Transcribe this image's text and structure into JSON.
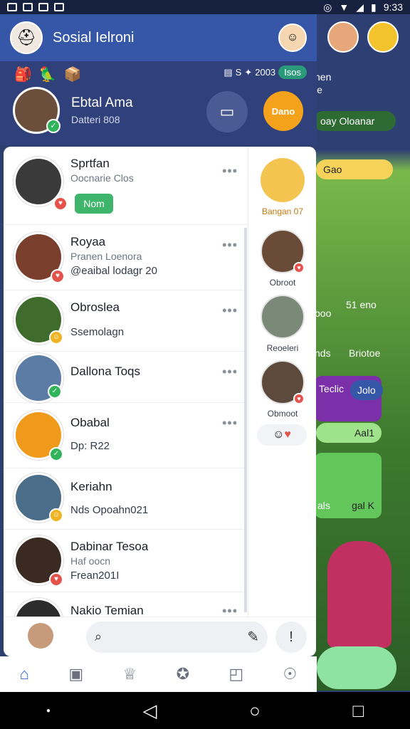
{
  "status_bar": {
    "time": "9:33",
    "icons_left": [
      "image-icon",
      "save-icon",
      "shield-icon",
      "heart-icon"
    ],
    "icons_right": [
      "alarm-icon",
      "wifi-icon",
      "signal-icon",
      "battery-icon"
    ]
  },
  "header": {
    "title": "Sosial Ielroni"
  },
  "sub_header": {
    "emojis": [
      "🎒",
      "🦜",
      "📦"
    ],
    "stat1": "S",
    "stat2": "2003",
    "stat_pill": "Isos"
  },
  "current_user": {
    "name": "Ebtal Ama",
    "sub": "Datteri 808",
    "btn_label": "Dano"
  },
  "chats": [
    {
      "name": "Sprtfan",
      "line1": "Oocnarie Clos",
      "line2": "",
      "button": "Nom"
    },
    {
      "name": "Royaa",
      "line1": "Pranen Loenora",
      "line2": "@eaibal lodagr 20"
    },
    {
      "name": "Obroslea",
      "line1": "",
      "line2": "Ssemolagn"
    },
    {
      "name": "Dallona Toqs",
      "line1": "",
      "line2": ""
    },
    {
      "name": "Obabal",
      "line1": "",
      "line2": "Dp: R22"
    },
    {
      "name": "Keriahn",
      "line1": "",
      "line2": "Nds Opoahn021"
    },
    {
      "name": "Dabinar Tesoa",
      "line1": "Haf oocn",
      "line2": "Frean201I"
    },
    {
      "name": "Nakio Temian",
      "line1": "",
      "line2": ""
    }
  ],
  "stories": [
    {
      "label": "Bangan 07"
    },
    {
      "label": "Obroot"
    },
    {
      "label": "Reoeleri"
    },
    {
      "label": "Obmoot"
    }
  ],
  "background": {
    "text1": "nen",
    "text2": "le",
    "pill1": "oay Oloanar",
    "pill2": "Gao",
    "label1": "boo",
    "label2": "51 eno",
    "label3": "nds",
    "label4": "Briotoe",
    "card_title": "Teclic",
    "card_num": "Jolo",
    "card_pill": "Aal1",
    "card_foot1": "als",
    "card_foot2": "gal K"
  },
  "bottom_nav": [
    "home-icon",
    "store-icon",
    "trophy-icon",
    "compass-icon",
    "bag-icon",
    "friends-icon"
  ]
}
